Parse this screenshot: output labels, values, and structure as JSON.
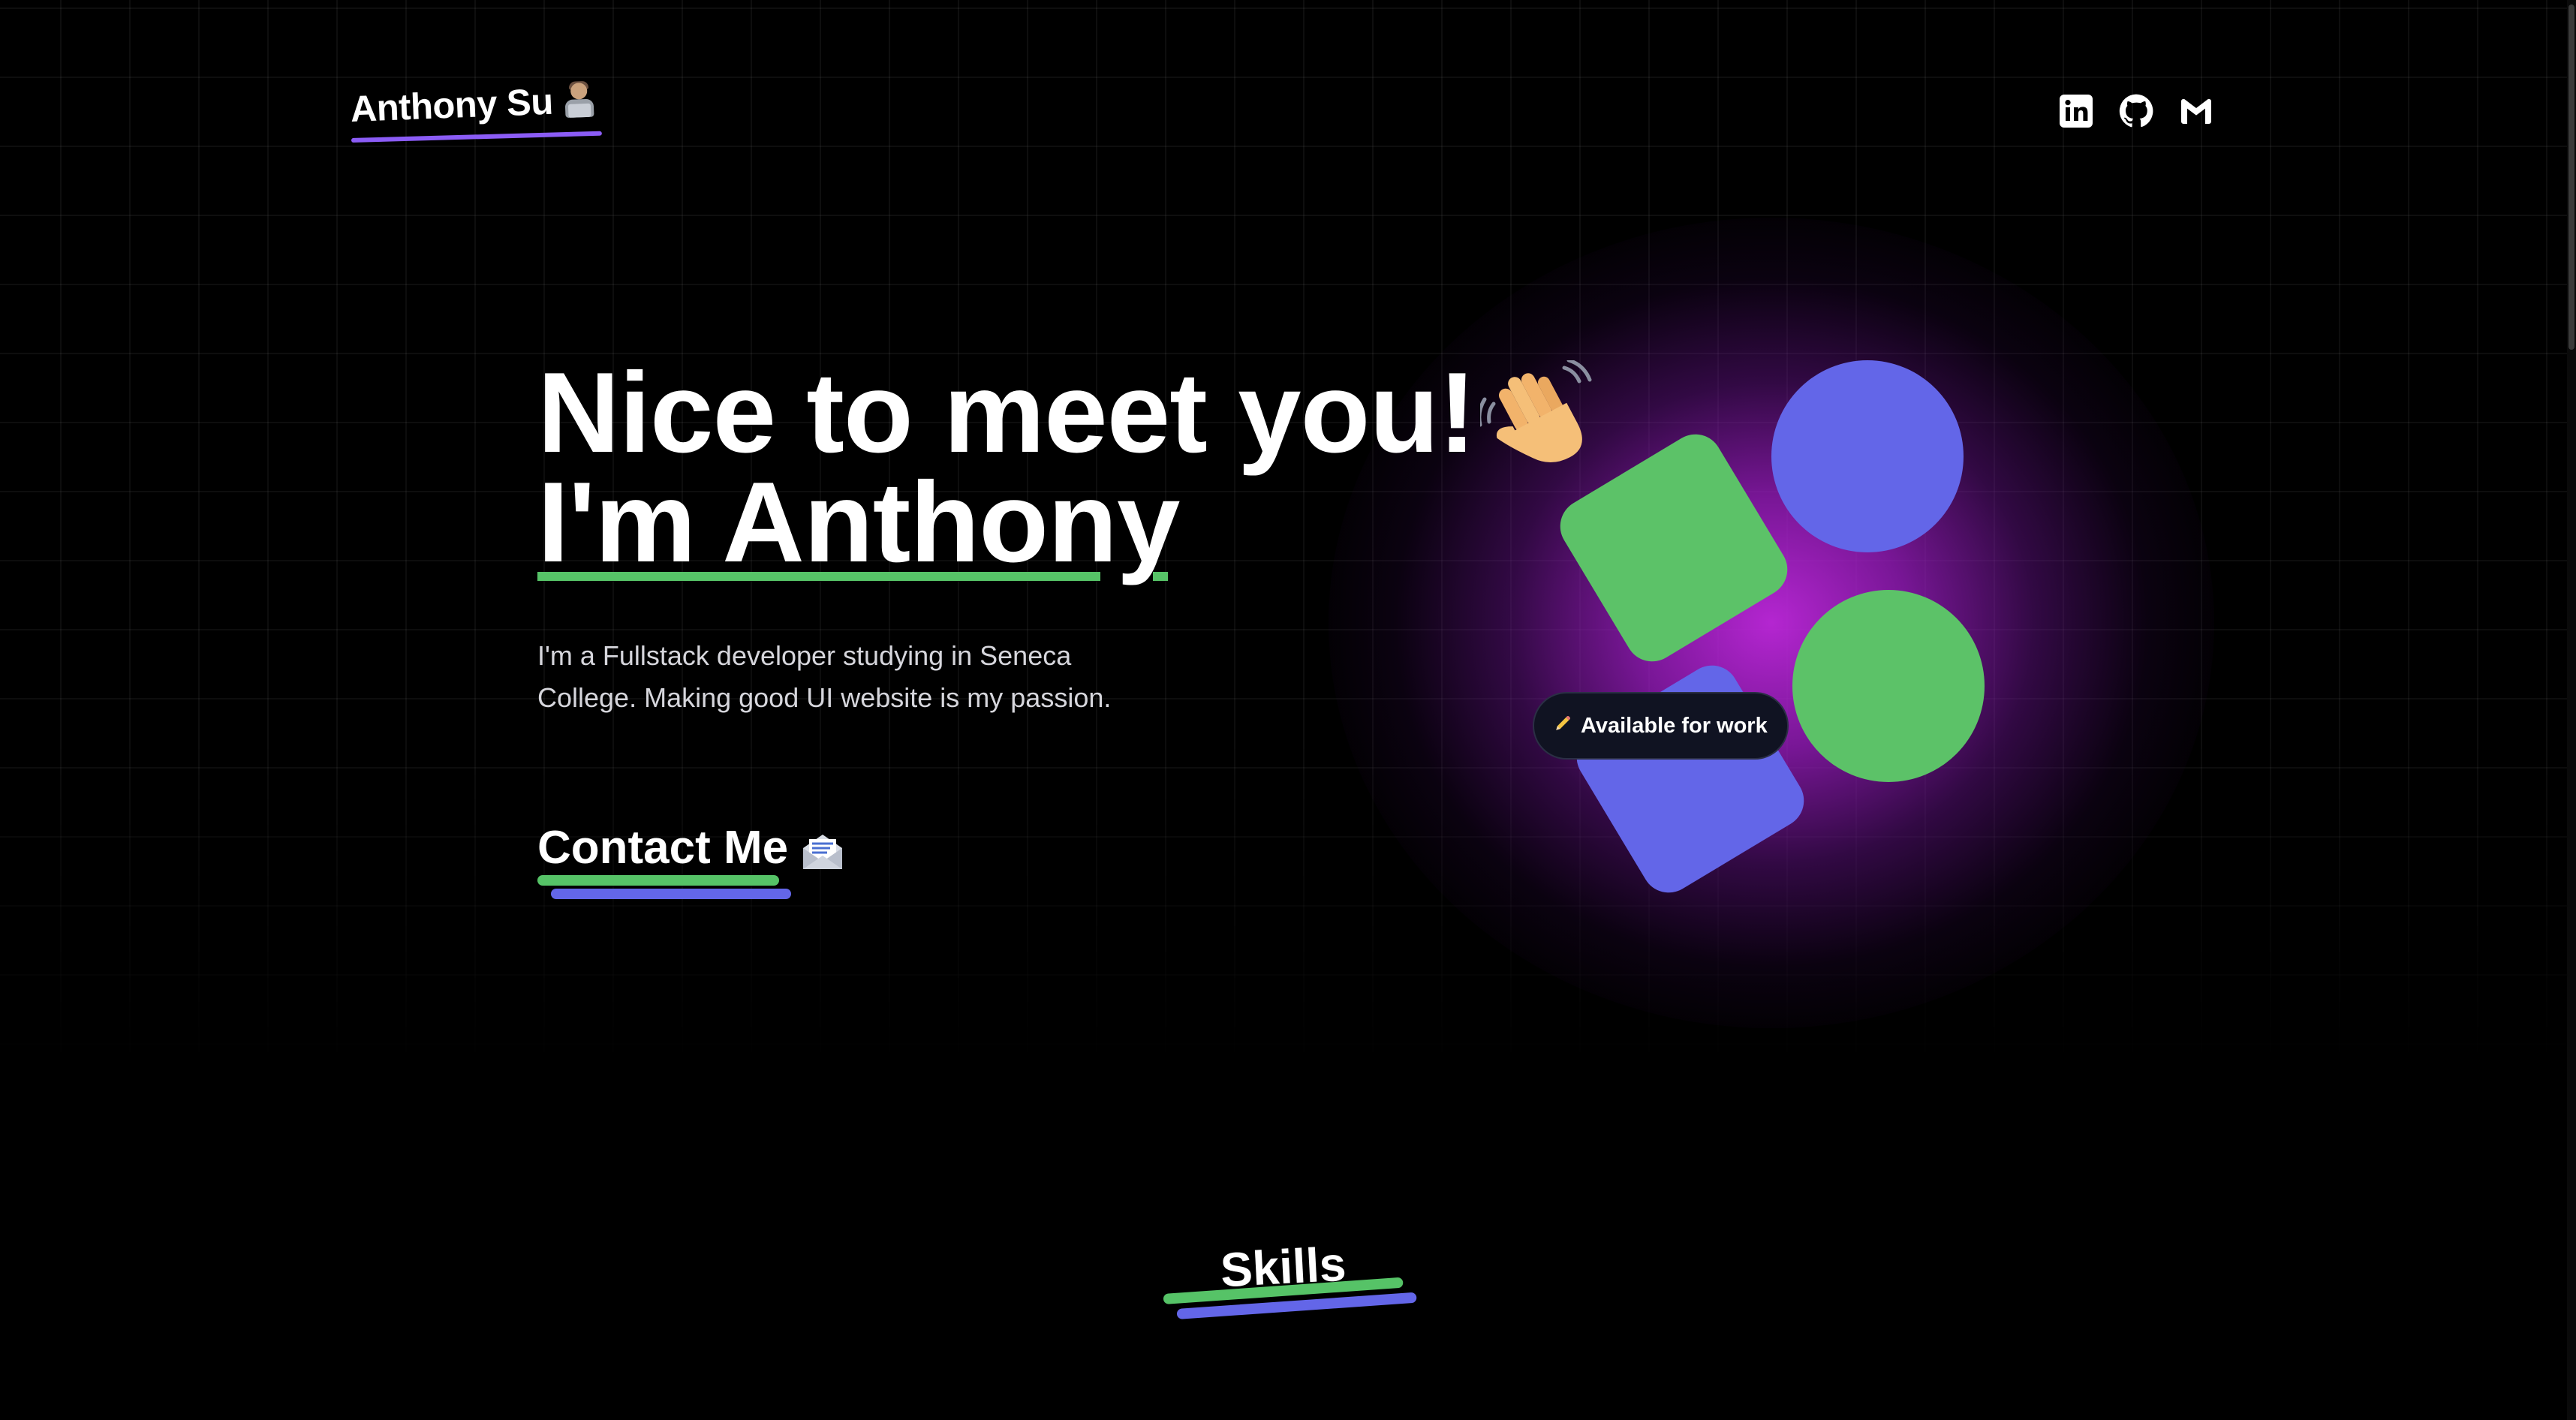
{
  "header": {
    "logo_text": "Anthony Su",
    "logo_emoji_icon": "technologist-emoji",
    "social_links": [
      {
        "name": "linkedin",
        "icon": "linkedin-icon"
      },
      {
        "name": "github",
        "icon": "github-icon"
      },
      {
        "name": "gmail",
        "icon": "gmail-icon"
      }
    ]
  },
  "hero": {
    "line1": "Nice to meet you!",
    "wave_icon": "waving-hand-emoji",
    "line2": "I'm Anthony",
    "description": "I'm a Fullstack developer studying in Seneca College. Making good UI website is my passion.",
    "contact_label": "Contact Me",
    "contact_icon": "envelope-emoji"
  },
  "art": {
    "badge_icon": "pencil-emoji",
    "badge_text": "Available for work",
    "colors": {
      "green": "#5cc268",
      "blue": "#6366e8",
      "glow": "#be28dc",
      "accent_purple": "#8b5cf6"
    }
  },
  "skills": {
    "title": "Skills"
  }
}
